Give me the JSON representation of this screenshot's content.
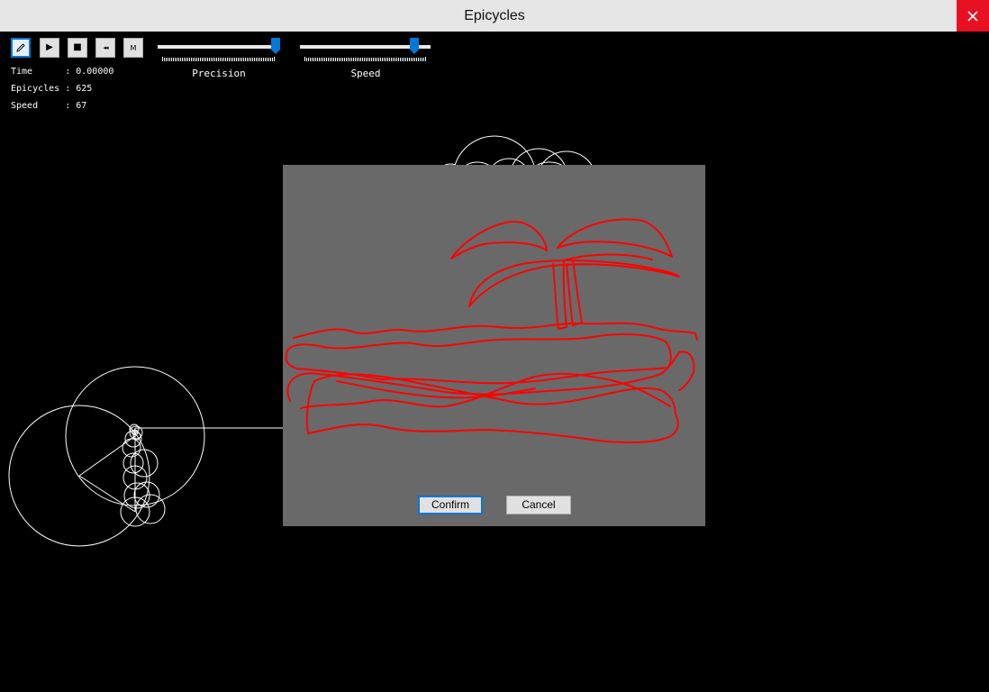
{
  "window": {
    "title": "Epicycles"
  },
  "toolbar": {
    "draw_button": {
      "icon": "pencil-icon"
    },
    "play_button": {
      "icon": "play-icon",
      "glyph": "▶"
    },
    "stop_button": {
      "icon": "stop-icon",
      "glyph": "■"
    },
    "rewind_button": {
      "icon": "rewind-icon",
      "glyph": "◂◂"
    },
    "mode_button": {
      "label": "M"
    }
  },
  "sliders": {
    "precision": {
      "label": "Precision",
      "value": 1.0
    },
    "speed": {
      "label": "Speed",
      "value": 0.9
    }
  },
  "info": {
    "time": "Time      : 0.00000",
    "epicycles": "Epicycles : 625",
    "speed": "Speed     : 67"
  },
  "dialog": {
    "confirm_label": "Confirm",
    "cancel_label": "Cancel"
  },
  "colors": {
    "accent": "#0078d7",
    "close_bg": "#e81123",
    "stroke": "#ff0000",
    "dialog_bg": "#696969"
  }
}
